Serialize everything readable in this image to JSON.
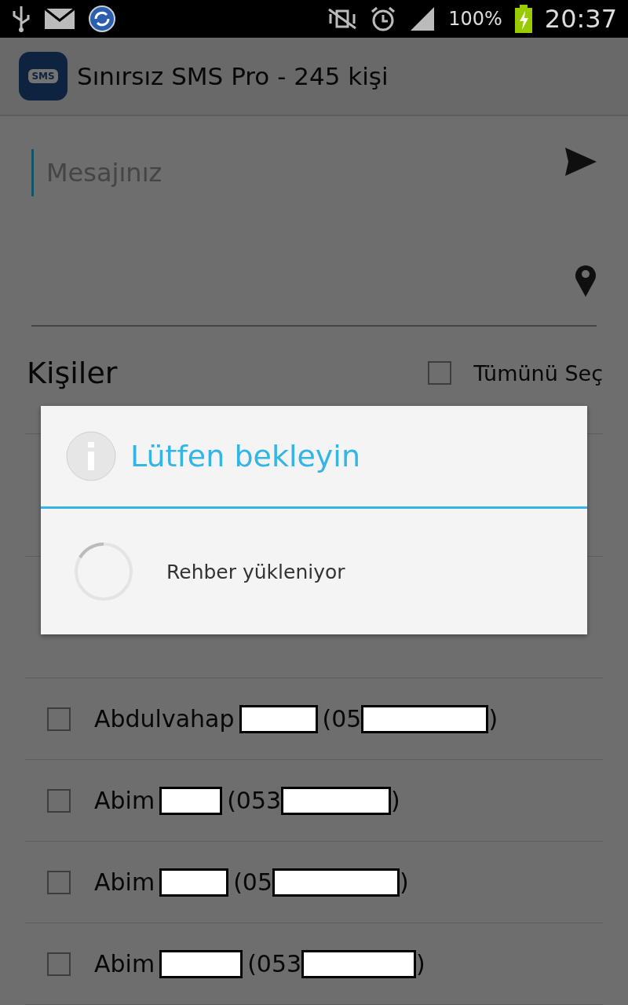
{
  "status_bar": {
    "battery": "100%",
    "time": "20:37"
  },
  "app_bar": {
    "title": "Sınırsız SMS Pro - 245 kişi",
    "logo_text": "SMS"
  },
  "message": {
    "placeholder": "Mesajınız"
  },
  "contacts_header": {
    "title": "Kişiler",
    "select_all": {
      "label": "Tümünü Seç",
      "checked": false
    }
  },
  "contacts": [
    {
      "name": "Abdulvahap",
      "phone_open": "(05",
      "phone_close": ")",
      "checked": false
    },
    {
      "name": "Abim",
      "phone_open": "(053",
      "phone_close": ")",
      "checked": false
    },
    {
      "name": "Abim",
      "phone_open": "(05",
      "phone_close": ")",
      "checked": false
    },
    {
      "name": "Abim",
      "phone_open": "(053",
      "phone_close": ")",
      "checked": false
    }
  ],
  "dialog": {
    "title": "Lütfen bekleyin",
    "message": "Rehber yükleniyor"
  }
}
